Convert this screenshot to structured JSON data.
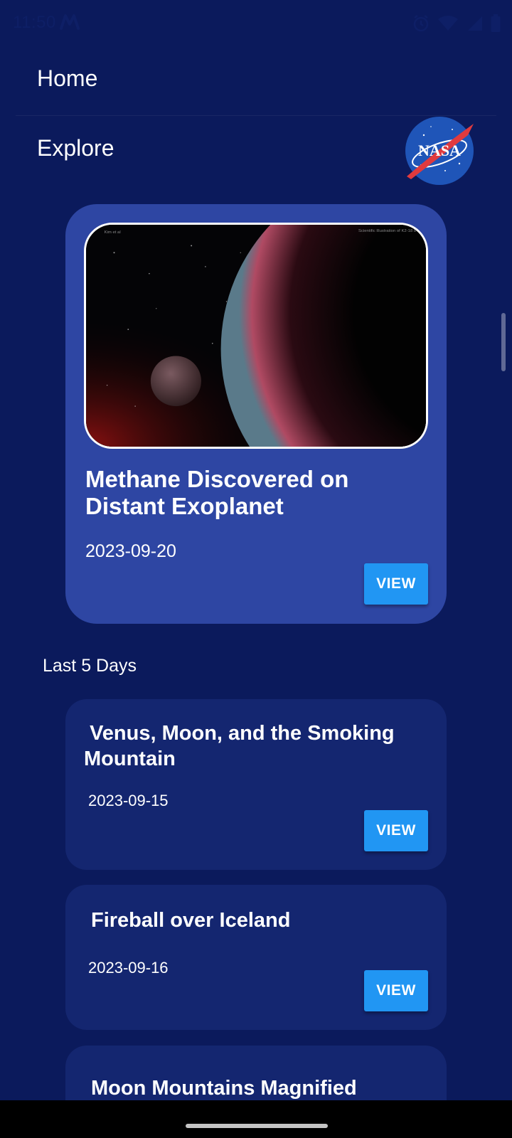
{
  "status_bar": {
    "time": "11:50",
    "icons": [
      "carrier-m-icon",
      "alarm-icon",
      "wifi-icon",
      "signal-icon",
      "battery-icon"
    ]
  },
  "menu": {
    "home_label": "Home",
    "explore_label": "Explore"
  },
  "logo": {
    "name": "nasa-logo",
    "text": "NASA"
  },
  "featured": {
    "title": "Methane Discovered on Distant Exoplanet",
    "date": "2023-09-20",
    "image_credit_left": "Kim et al",
    "image_credit_right": "Scientific Illustration of K2-18 b",
    "view_label": "VIEW"
  },
  "section": {
    "label": "Last 5 Days"
  },
  "items": [
    {
      "title": " Venus, Moon, and the Smoking Mountain",
      "date": "2023-09-15",
      "view_label": "VIEW"
    },
    {
      "title": "Fireball over Iceland",
      "date": "2023-09-16",
      "view_label": "VIEW"
    },
    {
      "title": "Moon Mountains Magnified"
    }
  ],
  "colors": {
    "background": "#0b1a5c",
    "featured_card": "#2e46a3",
    "list_card": "#142670",
    "button": "#2196f3"
  }
}
